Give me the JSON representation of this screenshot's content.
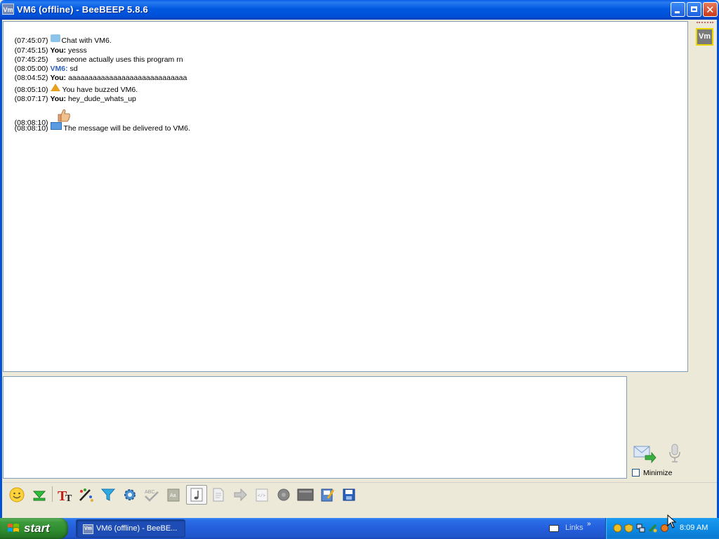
{
  "window": {
    "title": "VM6 (offline) - BeeBEEP 5.8.6",
    "app_icon_text": "Vm",
    "controls": [
      "minimize",
      "maximize",
      "close"
    ]
  },
  "chat": {
    "messages": [
      {
        "time": "(07:45:07)",
        "type": "system",
        "icon": "chat-bubble-icon",
        "text": "Chat with VM6."
      },
      {
        "time": "(07:45:15)",
        "type": "you",
        "sender": "You",
        "text": "yesss"
      },
      {
        "time": "(07:45:25)",
        "type": "continuation",
        "text": "someone actually uses this program rn"
      },
      {
        "time": "(08:05:00)",
        "type": "peer",
        "sender": "VM6",
        "text": "sd"
      },
      {
        "time": "(08:04:52)",
        "type": "you",
        "sender": "You",
        "text": "aaaaaaaaaaaaaaaaaaaaaaaaaaaaa"
      },
      {
        "time": "(08:05:10)",
        "type": "system",
        "icon": "bell-icon",
        "text": "You have buzzed VM6."
      },
      {
        "time": "(08:07:17)",
        "type": "you",
        "sender": "You",
        "text": "hey_dude_whats_up"
      },
      {
        "time": "(08:08:10)",
        "type": "emoticon",
        "icon": "thumbs-up-icon",
        "text": ""
      },
      {
        "time": "(08:08:10)",
        "type": "system",
        "icon": "mail-icon",
        "text": "The message will be delivered to VM6."
      }
    ]
  },
  "sidebar": {
    "avatar_text": "Vm",
    "avatar_border_color": "#E8D800"
  },
  "composer": {
    "input_value": "",
    "minimize_label": "Minimize",
    "minimize_checked": false
  },
  "toolbar": {
    "buttons": [
      "emoticons-icon",
      "download-icon",
      "font-icon",
      "color-icon",
      "filter-icon",
      "settings-icon",
      "spellcheck-icon",
      "dictionary-icon",
      "music-note-icon",
      "file-icon",
      "forward-icon",
      "html-icon",
      "record-icon",
      "screenshot-icon",
      "save-chat-icon",
      "save-icon"
    ],
    "pressed": "music-note-icon"
  },
  "taskbar": {
    "start_label": "start",
    "task_label": "VM6 (offline) - BeeBE...",
    "task_icon_text": "Vm",
    "links_label": "Links",
    "links_chevron": "»",
    "clock": "8:09 AM"
  },
  "colors": {
    "titlebar": "#0058E0",
    "peer_name": "#2E5FB8",
    "taskbar": "#245EDB",
    "start": "#3C9A3C",
    "tray": "#0E8AE4"
  }
}
